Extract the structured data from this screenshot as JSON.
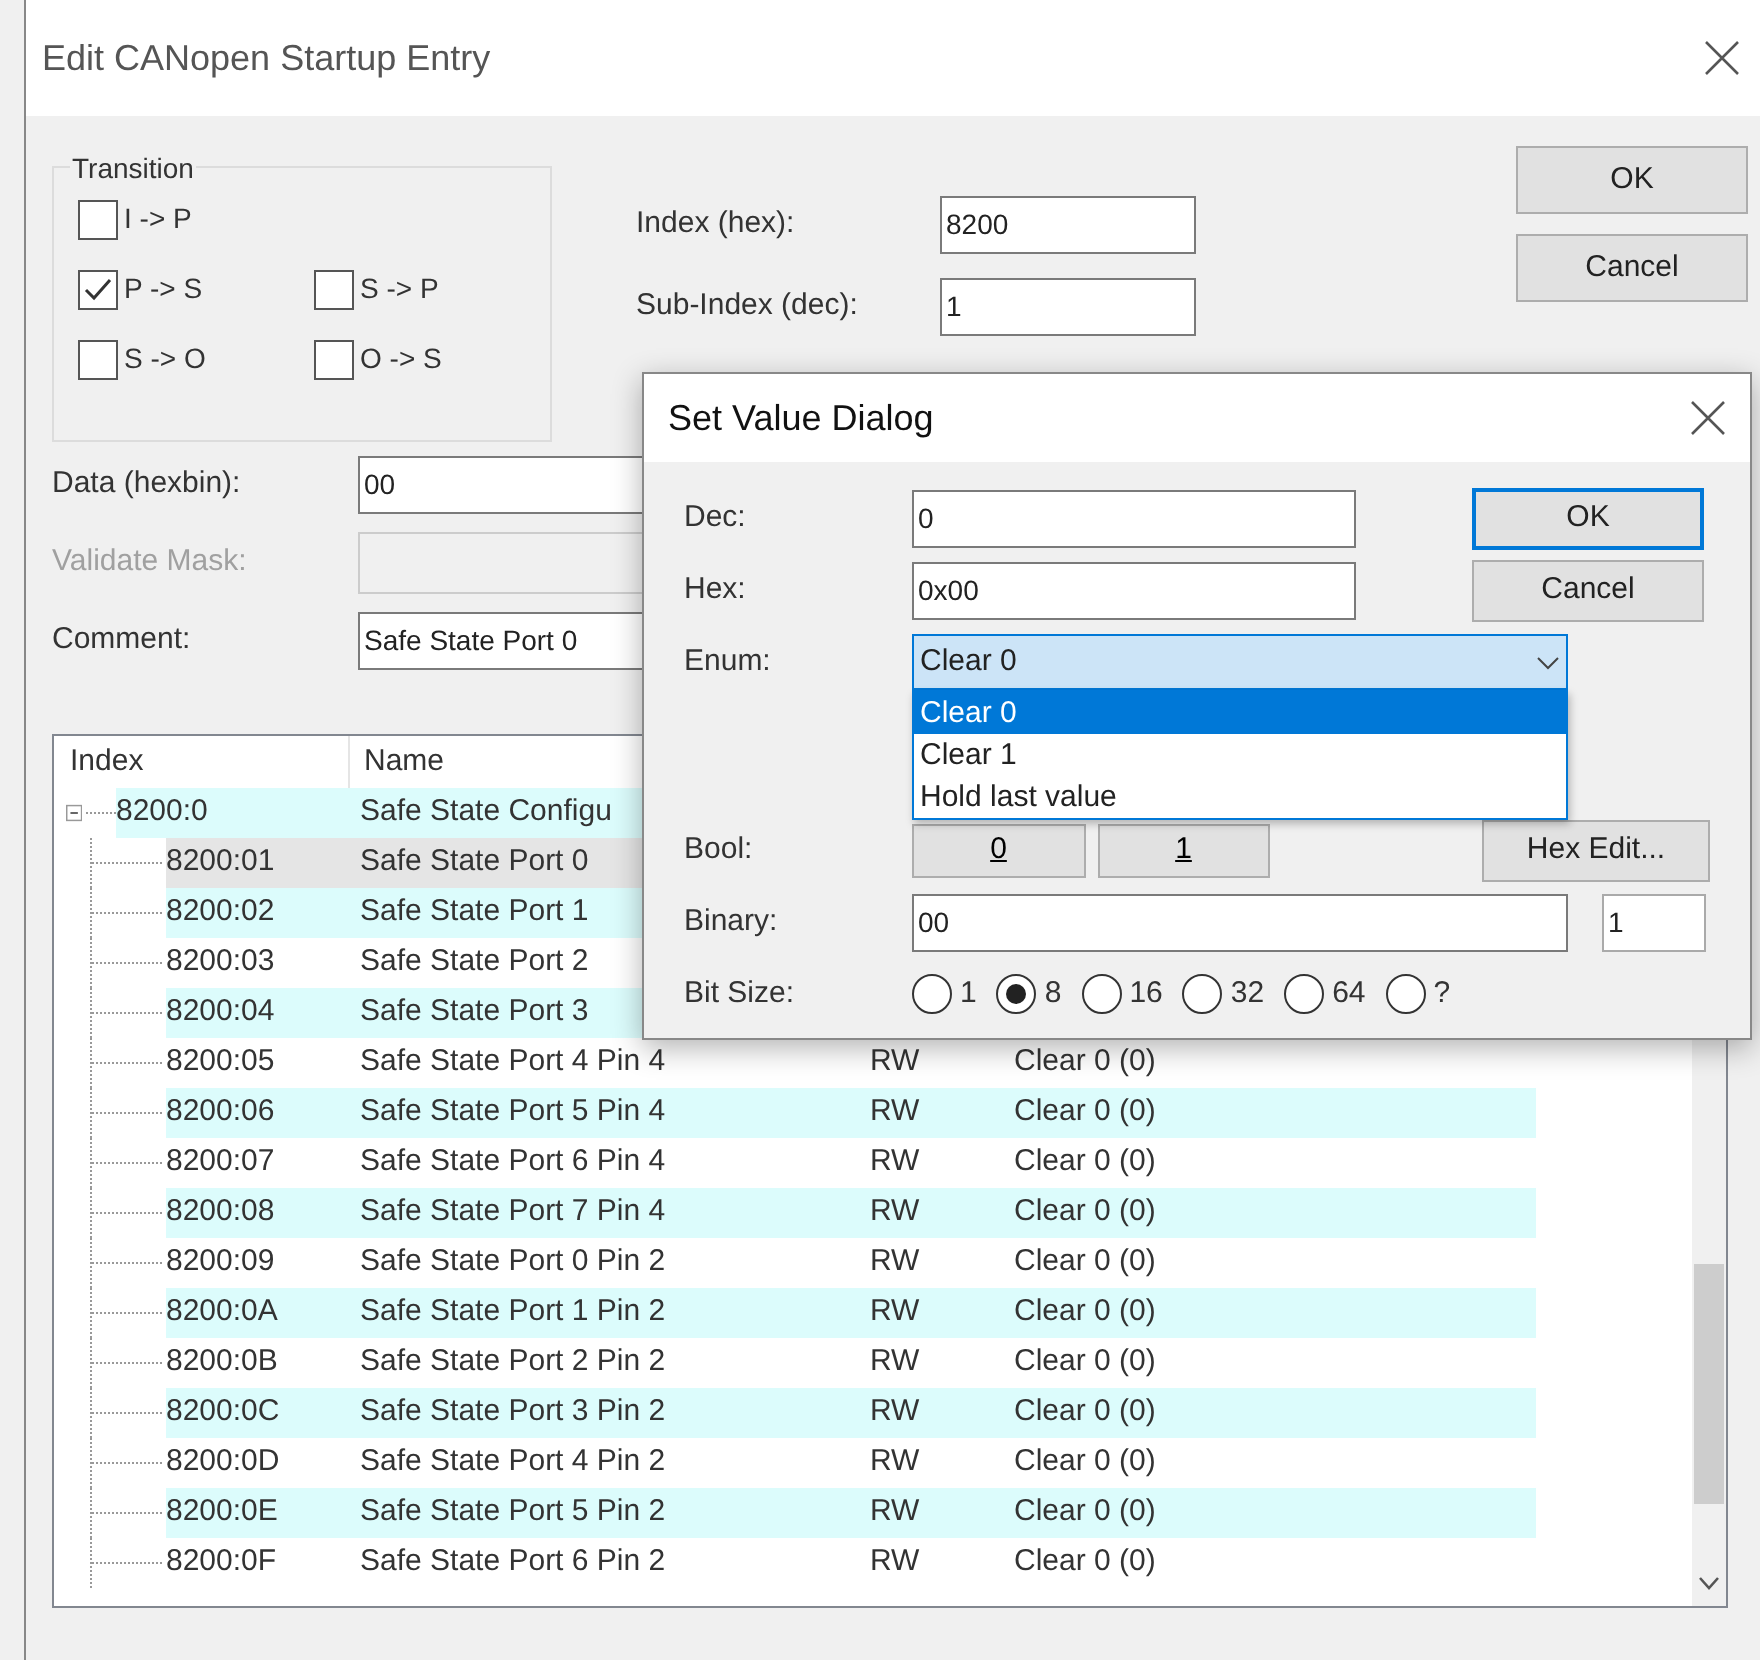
{
  "window": {
    "title": "Edit CANopen Startup Entry"
  },
  "transition": {
    "title": "Transition",
    "options": [
      {
        "label": "I -> P",
        "checked": false
      },
      {
        "label": "P -> S",
        "checked": true
      },
      {
        "label": "S -> P",
        "checked": false
      },
      {
        "label": "S -> O",
        "checked": false
      },
      {
        "label": "O -> S",
        "checked": false
      }
    ]
  },
  "index_field": {
    "label": "Index (hex):",
    "value": "8200"
  },
  "subindex_field": {
    "label": "Sub-Index (dec):",
    "value": "1"
  },
  "buttons": [
    "OK",
    "Cancel"
  ],
  "data_field": {
    "label": "Data (hexbin):",
    "value": "00"
  },
  "validate_mask": {
    "label": "Validate Mask:",
    "disabled": true
  },
  "comment_field": {
    "label": "Comment:",
    "value": "Safe State Port 0"
  },
  "table": {
    "columns": [
      "Index",
      "Name"
    ],
    "rows": [
      {
        "index": "8200:0",
        "name": "Safe State Configu",
        "expanded": true,
        "selected": false,
        "children": [
          {
            "index": "8200:01",
            "name": "Safe State Port 0",
            "selected": true
          },
          {
            "index": "8200:02",
            "name": "Safe State Port 1",
            "selected": false
          },
          {
            "index": "8200:03",
            "name": "Safe State Port 2",
            "selected": false
          },
          {
            "index": "8200:04",
            "name": "Safe State Port 3",
            "selected": false
          },
          {
            "index": "8200:05",
            "name": "Safe State Port 4 Pin 4",
            "access": "RW",
            "value": "Clear 0 (0)",
            "selected": false
          },
          {
            "index": "8200:06",
            "name": "Safe State Port 5 Pin 4",
            "access": "RW",
            "value": "Clear 0 (0)",
            "selected": false
          },
          {
            "index": "8200:07",
            "name": "Safe State Port 6 Pin 4",
            "access": "RW",
            "value": "Clear 0 (0)",
            "selected": false
          },
          {
            "index": "8200:08",
            "name": "Safe State Port 7 Pin 4",
            "access": "RW",
            "value": "Clear 0 (0)",
            "selected": false
          },
          {
            "index": "8200:09",
            "name": "Safe State Port 0 Pin 2",
            "access": "RW",
            "value": "Clear 0 (0)",
            "selected": false
          },
          {
            "index": "8200:0A",
            "name": "Safe State Port 1 Pin 2",
            "access": "RW",
            "value": "Clear 0 (0)",
            "selected": false
          },
          {
            "index": "8200:0B",
            "name": "Safe State Port 2 Pin 2",
            "access": "RW",
            "value": "Clear 0 (0)",
            "selected": false
          },
          {
            "index": "8200:0C",
            "name": "Safe State Port 3 Pin 2",
            "access": "RW",
            "value": "Clear 0 (0)",
            "selected": false
          },
          {
            "index": "8200:0D",
            "name": "Safe State Port 4 Pin 2",
            "access": "RW",
            "value": "Clear 0 (0)",
            "selected": false
          },
          {
            "index": "8200:0E",
            "name": "Safe State Port 5 Pin 2",
            "access": "RW",
            "value": "Clear 0 (0)",
            "selected": false
          },
          {
            "index": "8200:0F",
            "name": "Safe State Port 6 Pin 2",
            "access": "RW",
            "value": "Clear 0 (0)",
            "selected": false
          }
        ]
      }
    ]
  },
  "set_value_dialog": {
    "title": "Set Value Dialog",
    "dec": {
      "label": "Dec:",
      "value": "0"
    },
    "hex": {
      "label": "Hex:",
      "value": "0x00"
    },
    "enum": {
      "label": "Enum:",
      "value": "Clear 0",
      "expanded": true,
      "options": [
        {
          "label": "Clear 0",
          "selected": true
        },
        {
          "label": "Clear 1",
          "selected": false
        },
        {
          "label": "Hold last value",
          "selected": false
        }
      ]
    },
    "bool": {
      "label": "Bool:",
      "buttons": [
        "0",
        "1"
      ]
    },
    "hex_edit": "Hex Edit...",
    "binary": {
      "label": "Binary:",
      "value": "00",
      "length": "1"
    },
    "bit_size": {
      "label": "Bit Size:",
      "options": [
        {
          "label": "1",
          "selected": false
        },
        {
          "label": "8",
          "selected": true
        },
        {
          "label": "16",
          "selected": false
        },
        {
          "label": "32",
          "selected": false
        },
        {
          "label": "64",
          "selected": false
        },
        {
          "label": "?",
          "selected": false
        }
      ]
    },
    "buttons": [
      {
        "label": "OK",
        "focused": true
      },
      {
        "label": "Cancel",
        "focused": false
      }
    ]
  }
}
